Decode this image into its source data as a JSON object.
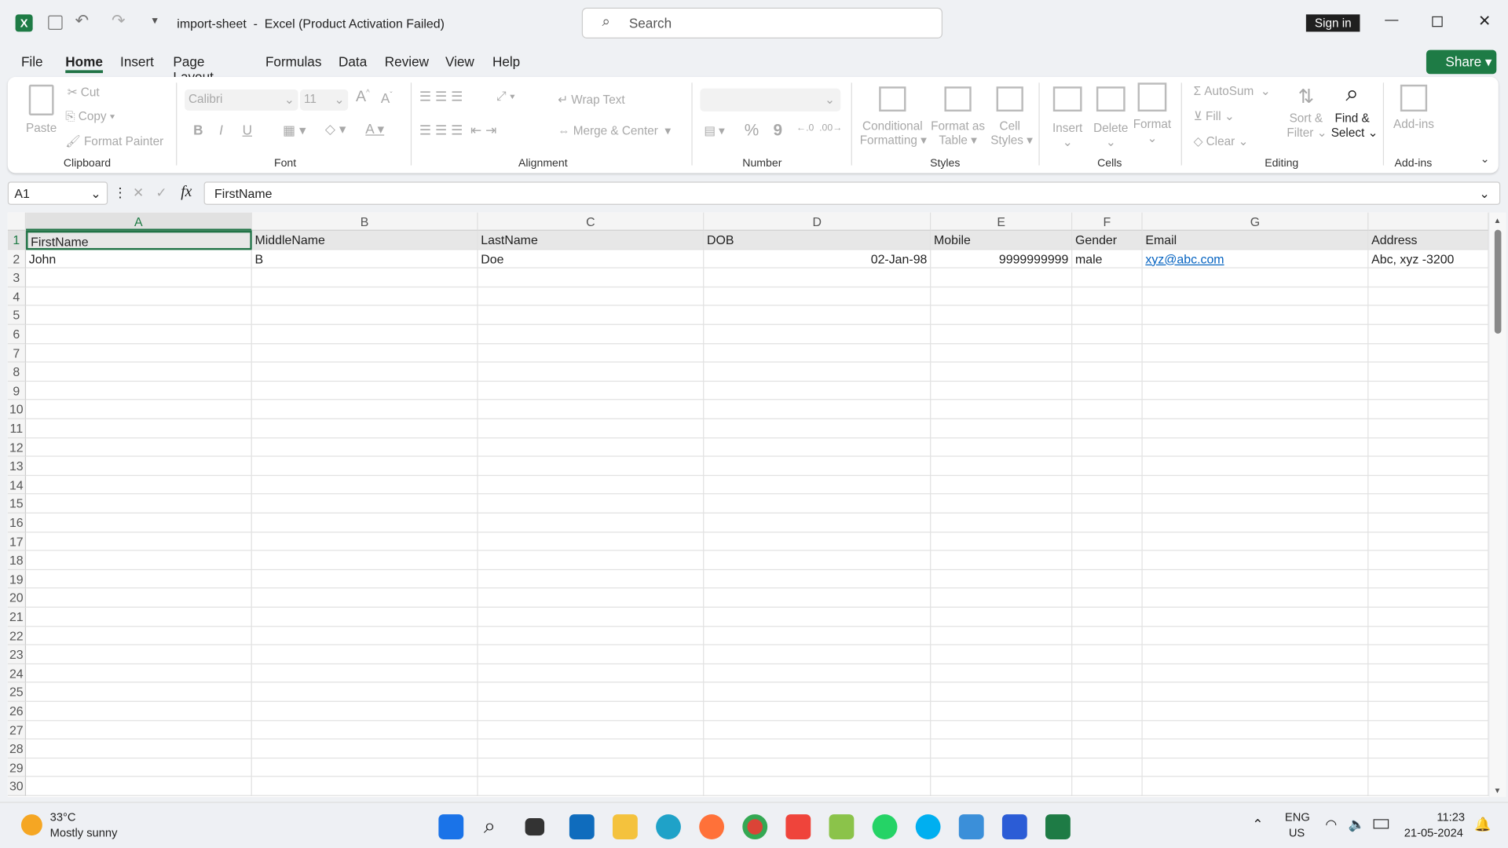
{
  "title": {
    "doc": "import-sheet",
    "app": "Excel (Product Activation Failed)",
    "search_placeholder": "Search",
    "sign_in": "Sign in",
    "share": "Share"
  },
  "tabs": [
    "File",
    "Home",
    "Insert",
    "Page Layout",
    "Formulas",
    "Data",
    "Review",
    "View",
    "Help"
  ],
  "active_tab": "Home",
  "ribbon": {
    "clipboard": {
      "label": "Clipboard",
      "paste": "Paste",
      "cut": "Cut",
      "copy": "Copy",
      "format_painter": "Format Painter"
    },
    "font": {
      "label": "Font",
      "name": "Calibri",
      "size": "11",
      "bold": "B",
      "italic": "I",
      "underline": "U"
    },
    "alignment": {
      "label": "Alignment",
      "wrap": "Wrap Text",
      "merge": "Merge & Center"
    },
    "number": {
      "label": "Number",
      "percent": "%",
      "comma": "9"
    },
    "styles": {
      "label": "Styles",
      "cond1": "Conditional",
      "cond2": "Formatting",
      "fat1": "Format as",
      "fat2": "Table",
      "cs1": "Cell",
      "cs2": "Styles"
    },
    "cells": {
      "label": "Cells",
      "insert": "Insert",
      "delete": "Delete",
      "format": "Format"
    },
    "editing": {
      "label": "Editing",
      "autosum": "AutoSum",
      "fill": "Fill",
      "clear": "Clear",
      "sort1": "Sort &",
      "sort2": "Filter",
      "find1": "Find &",
      "find2": "Select"
    },
    "addins": {
      "label": "Add-ins",
      "addins": "Add-ins"
    }
  },
  "formula_bar": {
    "name_box": "A1",
    "fx": "fx",
    "value": "FirstName"
  },
  "columns": [
    "A",
    "B",
    "C",
    "D",
    "E",
    "F",
    "G"
  ],
  "rows": [
    [
      "FirstName",
      "MiddleName",
      "LastName",
      "DOB",
      "Mobile",
      "Gender",
      "Email",
      "Address"
    ],
    [
      "John",
      "B",
      "Doe",
      "02-Jan-98",
      "9999999999",
      "male",
      "xyz@abc.com",
      "Abc, xyz -3200"
    ]
  ],
  "row_count": 30,
  "taskbar": {
    "temp": "33°C",
    "weather": "Mostly sunny",
    "lang1": "ENG",
    "lang2": "US",
    "time": "11:23",
    "date": "21-05-2024"
  },
  "colors": {
    "excel_green": "#217346",
    "share": "#1e7b45",
    "link": "#0563c1"
  }
}
